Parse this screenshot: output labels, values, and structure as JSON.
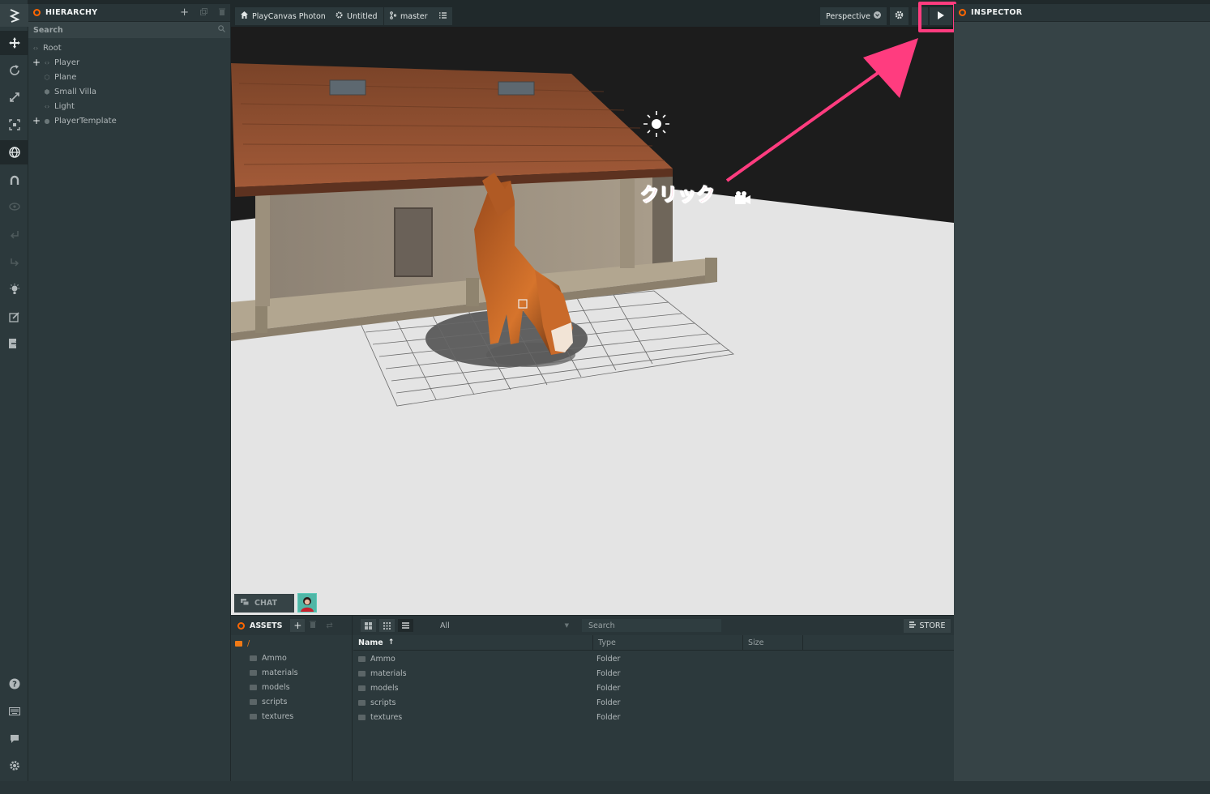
{
  "hierarchy": {
    "title": "HIERARCHY",
    "search_placeholder": "Search",
    "items": [
      {
        "label": "Root",
        "expander": "",
        "icon": "entity-icon"
      },
      {
        "label": "Player",
        "expander": "+",
        "icon": "entity-icon"
      },
      {
        "label": "Plane",
        "expander": "",
        "icon": "model-icon"
      },
      {
        "label": "Small Villa",
        "expander": "",
        "icon": "model-icon"
      },
      {
        "label": "Light",
        "expander": "",
        "icon": "entity-icon"
      },
      {
        "label": "PlayerTemplate",
        "expander": "+",
        "icon": "template-icon"
      }
    ]
  },
  "topbar": {
    "project": "PlayCanvas Photon",
    "scene": "Untitled",
    "branch": "master",
    "camera": "Perspective"
  },
  "annotation": "クリック",
  "chat": {
    "label": "CHAT"
  },
  "assets": {
    "title": "ASSETS",
    "filter": "All",
    "search_placeholder": "Search",
    "store_label": "STORE",
    "root": "/",
    "folders": [
      "Ammo",
      "materials",
      "models",
      "scripts",
      "textures"
    ],
    "columns": {
      "name": "Name",
      "type": "Type",
      "size": "Size"
    },
    "rows": [
      {
        "name": "Ammo",
        "type": "Folder"
      },
      {
        "name": "materials",
        "type": "Folder"
      },
      {
        "name": "models",
        "type": "Folder"
      },
      {
        "name": "scripts",
        "type": "Folder"
      },
      {
        "name": "textures",
        "type": "Folder"
      }
    ]
  },
  "inspector": {
    "title": "INSPECTOR"
  },
  "colors": {
    "accent": "#ff6600",
    "highlight": "#ff3c7f",
    "panel": "#2c393c"
  }
}
